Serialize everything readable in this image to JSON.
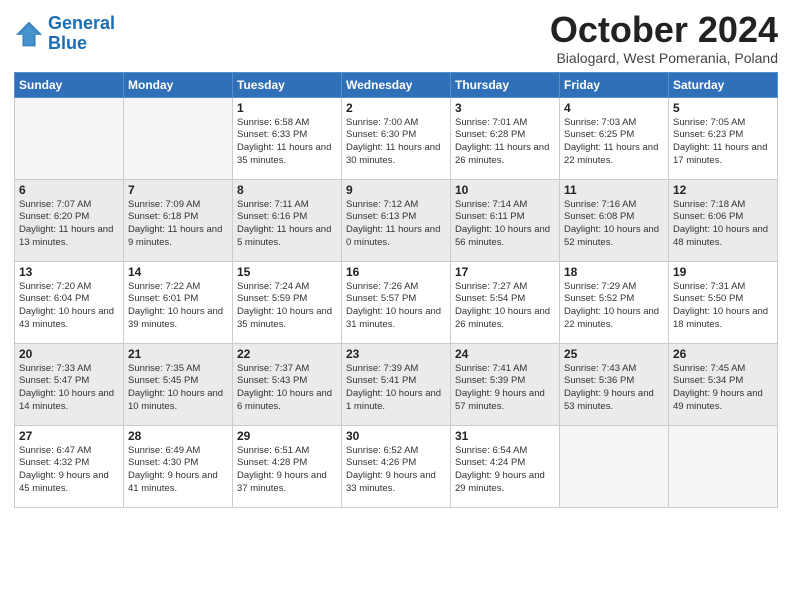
{
  "logo": {
    "line1": "General",
    "line2": "Blue"
  },
  "header": {
    "month": "October 2024",
    "location": "Bialogard, West Pomerania, Poland"
  },
  "days_of_week": [
    "Sunday",
    "Monday",
    "Tuesday",
    "Wednesday",
    "Thursday",
    "Friday",
    "Saturday"
  ],
  "weeks": [
    [
      {
        "day": "",
        "text": "",
        "empty": true
      },
      {
        "day": "",
        "text": "",
        "empty": true
      },
      {
        "day": "1",
        "text": "Sunrise: 6:58 AM\nSunset: 6:33 PM\nDaylight: 11 hours and 35 minutes."
      },
      {
        "day": "2",
        "text": "Sunrise: 7:00 AM\nSunset: 6:30 PM\nDaylight: 11 hours and 30 minutes."
      },
      {
        "day": "3",
        "text": "Sunrise: 7:01 AM\nSunset: 6:28 PM\nDaylight: 11 hours and 26 minutes."
      },
      {
        "day": "4",
        "text": "Sunrise: 7:03 AM\nSunset: 6:25 PM\nDaylight: 11 hours and 22 minutes."
      },
      {
        "day": "5",
        "text": "Sunrise: 7:05 AM\nSunset: 6:23 PM\nDaylight: 11 hours and 17 minutes."
      }
    ],
    [
      {
        "day": "6",
        "text": "Sunrise: 7:07 AM\nSunset: 6:20 PM\nDaylight: 11 hours and 13 minutes."
      },
      {
        "day": "7",
        "text": "Sunrise: 7:09 AM\nSunset: 6:18 PM\nDaylight: 11 hours and 9 minutes."
      },
      {
        "day": "8",
        "text": "Sunrise: 7:11 AM\nSunset: 6:16 PM\nDaylight: 11 hours and 5 minutes."
      },
      {
        "day": "9",
        "text": "Sunrise: 7:12 AM\nSunset: 6:13 PM\nDaylight: 11 hours and 0 minutes."
      },
      {
        "day": "10",
        "text": "Sunrise: 7:14 AM\nSunset: 6:11 PM\nDaylight: 10 hours and 56 minutes."
      },
      {
        "day": "11",
        "text": "Sunrise: 7:16 AM\nSunset: 6:08 PM\nDaylight: 10 hours and 52 minutes."
      },
      {
        "day": "12",
        "text": "Sunrise: 7:18 AM\nSunset: 6:06 PM\nDaylight: 10 hours and 48 minutes."
      }
    ],
    [
      {
        "day": "13",
        "text": "Sunrise: 7:20 AM\nSunset: 6:04 PM\nDaylight: 10 hours and 43 minutes."
      },
      {
        "day": "14",
        "text": "Sunrise: 7:22 AM\nSunset: 6:01 PM\nDaylight: 10 hours and 39 minutes."
      },
      {
        "day": "15",
        "text": "Sunrise: 7:24 AM\nSunset: 5:59 PM\nDaylight: 10 hours and 35 minutes."
      },
      {
        "day": "16",
        "text": "Sunrise: 7:26 AM\nSunset: 5:57 PM\nDaylight: 10 hours and 31 minutes."
      },
      {
        "day": "17",
        "text": "Sunrise: 7:27 AM\nSunset: 5:54 PM\nDaylight: 10 hours and 26 minutes."
      },
      {
        "day": "18",
        "text": "Sunrise: 7:29 AM\nSunset: 5:52 PM\nDaylight: 10 hours and 22 minutes."
      },
      {
        "day": "19",
        "text": "Sunrise: 7:31 AM\nSunset: 5:50 PM\nDaylight: 10 hours and 18 minutes."
      }
    ],
    [
      {
        "day": "20",
        "text": "Sunrise: 7:33 AM\nSunset: 5:47 PM\nDaylight: 10 hours and 14 minutes."
      },
      {
        "day": "21",
        "text": "Sunrise: 7:35 AM\nSunset: 5:45 PM\nDaylight: 10 hours and 10 minutes."
      },
      {
        "day": "22",
        "text": "Sunrise: 7:37 AM\nSunset: 5:43 PM\nDaylight: 10 hours and 6 minutes."
      },
      {
        "day": "23",
        "text": "Sunrise: 7:39 AM\nSunset: 5:41 PM\nDaylight: 10 hours and 1 minute."
      },
      {
        "day": "24",
        "text": "Sunrise: 7:41 AM\nSunset: 5:39 PM\nDaylight: 9 hours and 57 minutes."
      },
      {
        "day": "25",
        "text": "Sunrise: 7:43 AM\nSunset: 5:36 PM\nDaylight: 9 hours and 53 minutes."
      },
      {
        "day": "26",
        "text": "Sunrise: 7:45 AM\nSunset: 5:34 PM\nDaylight: 9 hours and 49 minutes."
      }
    ],
    [
      {
        "day": "27",
        "text": "Sunrise: 6:47 AM\nSunset: 4:32 PM\nDaylight: 9 hours and 45 minutes."
      },
      {
        "day": "28",
        "text": "Sunrise: 6:49 AM\nSunset: 4:30 PM\nDaylight: 9 hours and 41 minutes."
      },
      {
        "day": "29",
        "text": "Sunrise: 6:51 AM\nSunset: 4:28 PM\nDaylight: 9 hours and 37 minutes."
      },
      {
        "day": "30",
        "text": "Sunrise: 6:52 AM\nSunset: 4:26 PM\nDaylight: 9 hours and 33 minutes."
      },
      {
        "day": "31",
        "text": "Sunrise: 6:54 AM\nSunset: 4:24 PM\nDaylight: 9 hours and 29 minutes."
      },
      {
        "day": "",
        "text": "",
        "empty": true
      },
      {
        "day": "",
        "text": "",
        "empty": true
      }
    ]
  ]
}
